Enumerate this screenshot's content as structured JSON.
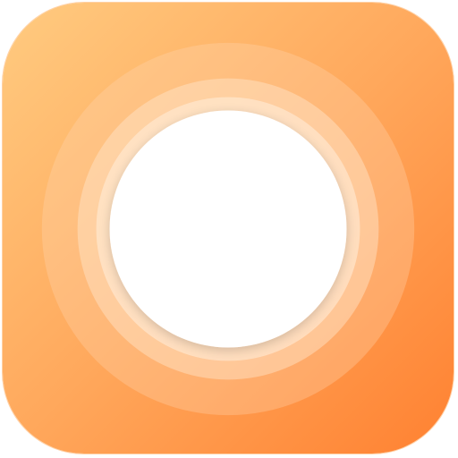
{
  "app_icon": {
    "icon": "assistive-touch-button-icon",
    "colors": {
      "gradient_top_left": "#FFCB80",
      "gradient_mid": "#FFA85C",
      "gradient_bottom_right": "#FF8131",
      "outer_ring": "#FFD8B0",
      "middle_ring": "#FFE6CC",
      "inner_ring": "#FFEFDD",
      "center_disc": "#FFFFFF"
    }
  }
}
